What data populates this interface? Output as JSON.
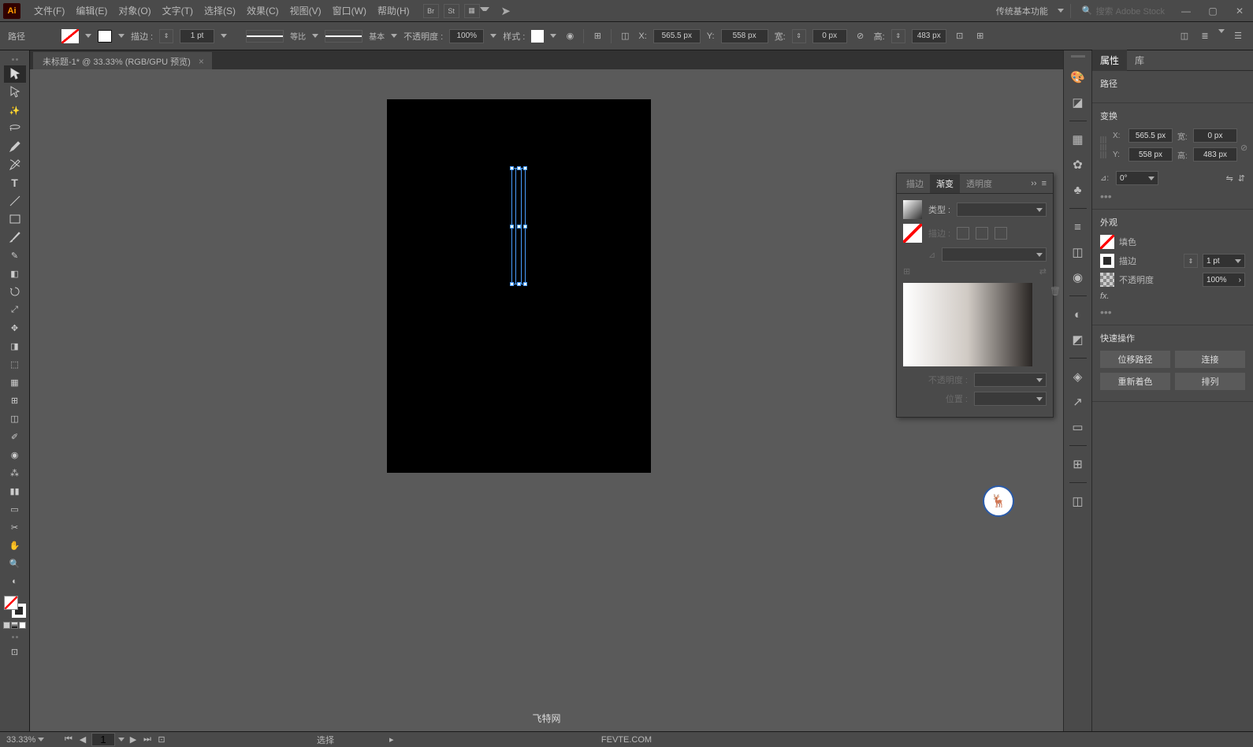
{
  "menubar": {
    "logo": "Ai",
    "items": [
      "文件(F)",
      "编辑(E)",
      "对象(O)",
      "文字(T)",
      "选择(S)",
      "效果(C)",
      "视图(V)",
      "窗口(W)",
      "帮助(H)"
    ],
    "apps": [
      "Br",
      "St"
    ],
    "workspace": "传统基本功能",
    "search_placeholder": "搜索 Adobe Stock"
  },
  "ctrlbar": {
    "object_type": "路径",
    "stroke_label": "描边 :",
    "stroke_value": "1 pt",
    "profile1": "等比",
    "profile2": "基本",
    "opacity_label": "不透明度 :",
    "opacity_value": "100%",
    "style_label": "样式 :",
    "x_label": "X:",
    "x_value": "565.5 px",
    "y_label": "Y:",
    "y_value": "558 px",
    "w_label": "宽:",
    "w_value": "0 px",
    "h_label": "高:",
    "h_value": "483 px"
  },
  "doc": {
    "tab_title": "未标题-1* @ 33.33% (RGB/GPU 预览)"
  },
  "gradient_panel": {
    "tabs": [
      "描边",
      "渐变",
      "透明度"
    ],
    "type_label": "类型 :",
    "stroke_label": "描边 :",
    "angle_icon": "⊿",
    "opacity_label": "不透明度 :",
    "position_label": "位置 :"
  },
  "props": {
    "tabs": [
      "属性",
      "库"
    ],
    "object_label": "路径",
    "transform_title": "变换",
    "x_label": "X:",
    "x_value": "565.5 px",
    "y_label": "Y:",
    "y_value": "558 px",
    "w_label": "宽:",
    "w_value": "0 px",
    "h_label": "高:",
    "h_value": "483 px",
    "angle_label": "⊿:",
    "angle_value": "0°",
    "appearance_title": "外观",
    "fill_label": "填色",
    "stroke_label": "描边",
    "stroke_value": "1 pt",
    "opacity_label": "不透明度",
    "opacity_value": "100%",
    "fx_label": "fx.",
    "quick_title": "快速操作",
    "btn1": "位移路径",
    "btn2": "连接",
    "btn3": "重新着色",
    "btn4": "排列"
  },
  "status": {
    "zoom": "33.33%",
    "page": "1",
    "tool": "选择",
    "site1": "飞特网",
    "site2": "FEVTE.COM"
  }
}
